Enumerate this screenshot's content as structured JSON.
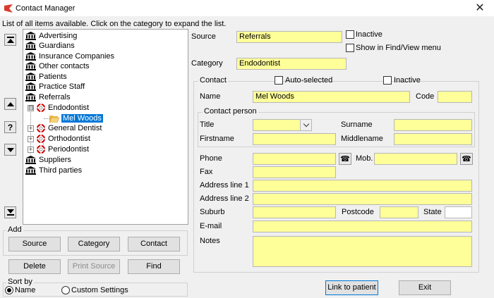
{
  "window": {
    "title": "Contact Manager",
    "close_glyph": "✕"
  },
  "info_line": "List of all items available. Click on the category to expand the list.",
  "tree": {
    "items": [
      {
        "label": "Advertising",
        "icon": "bank-icon"
      },
      {
        "label": "Guardians",
        "icon": "bank-icon"
      },
      {
        "label": "Insurance Companies",
        "icon": "bank-icon"
      },
      {
        "label": "Other contacts",
        "icon": "bank-icon"
      },
      {
        "label": "Patients",
        "icon": "bank-icon"
      },
      {
        "label": "Practice Staff",
        "icon": "bank-icon"
      },
      {
        "label": "Referrals",
        "icon": "bank-icon"
      },
      {
        "label": "Endodontist",
        "icon": "lifering-icon",
        "expander": "⊟"
      },
      {
        "label": "Mel Woods",
        "icon": "folder-open-icon",
        "selected": true
      },
      {
        "label": "General Dentist",
        "icon": "lifering-icon",
        "expander": "+"
      },
      {
        "label": "Orthodontist",
        "icon": "lifering-icon",
        "expander": "+"
      },
      {
        "label": "Periodontist",
        "icon": "lifering-icon",
        "expander": "+"
      },
      {
        "label": "Suppliers",
        "icon": "bank-icon"
      },
      {
        "label": "Third parties",
        "icon": "bank-icon"
      }
    ]
  },
  "add_group": {
    "label": "Add",
    "source_button": "Source",
    "category_button": "Category",
    "contact_button": "Contact"
  },
  "actions": {
    "delete_button": "Delete",
    "print_source_button": "Print Source",
    "find_button": "Find"
  },
  "sort_by": {
    "label": "Sort by",
    "name_option": "Name",
    "custom_option": "Custom Settings",
    "selected": "Name"
  },
  "details": {
    "source_label": "Source",
    "source_value": "Referrals",
    "inactive_label": "Inactive",
    "show_in_find_label": "Show in Find/View menu",
    "category_label": "Category",
    "category_value": "Endodontist",
    "contact_group_label": "Contact",
    "auto_selected_label": "Auto-selected",
    "contact_inactive_label": "Inactive",
    "name_label": "Name",
    "name_value": "Mel Woods",
    "code_label": "Code",
    "code_value": "",
    "contact_person_label": "Contact  person",
    "title_label": "Title",
    "title_value": "",
    "surname_label": "Surname",
    "surname_value": "",
    "firstname_label": "Firstname",
    "firstname_value": "",
    "middlename_label": "Middlename",
    "middlename_value": "",
    "phone_label": "Phone",
    "phone_value": "",
    "mob_label": "Mob.",
    "mob_value": "",
    "fax_label": "Fax",
    "fax_value": "",
    "address1_label": "Address line 1",
    "address1_value": "",
    "address2_label": "Address line 2",
    "address2_value": "",
    "suburb_label": "Suburb",
    "suburb_value": "",
    "postcode_label": "Postcode",
    "postcode_value": "",
    "state_label": "State",
    "state_value": "",
    "email_label": "E-mail",
    "email_value": "",
    "notes_label": "Notes",
    "notes_value": ""
  },
  "footer": {
    "link_button": "Link to patient",
    "exit_button": "Exit"
  },
  "colors": {
    "field_yellow": "#ffff99",
    "selection_blue": "#0078d7"
  }
}
